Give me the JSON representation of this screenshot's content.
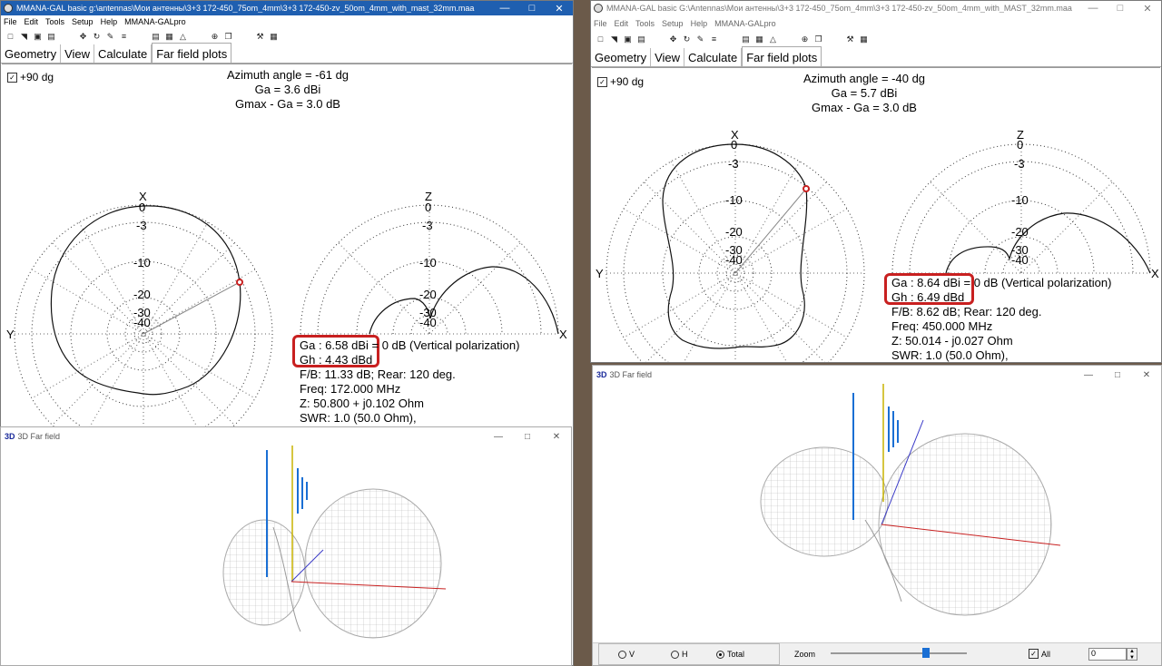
{
  "left": {
    "title": "MMANA-GAL basic g:\\antennas\\Мои антенны\\3+3 172-450_75om_4mm\\3+3 172-450-zv_50om_4mm_with_mast_32mm.maa",
    "menu": [
      "File",
      "Edit",
      "Tools",
      "Setup",
      "Help",
      "MMANA-GALpro"
    ],
    "tabs": [
      "Geometry",
      "View",
      "Calculate",
      "Far field plots"
    ],
    "plus90": "+90 dg",
    "azimuth": "Azimuth angle = -61 dg",
    "ga_line": "Ga = 3.6 dBi",
    "gmax_line": "Gmax - Ga = 3.0 dB",
    "ga_info": "Ga : 6.58 dBi = 0 dB  (Vertical polarization)",
    "gh_info": "Gh : 4.43 dBd",
    "fb": "F/B: 11.33 dB; Rear: 120 deg.",
    "freq": "Freq: 172.000 MHz",
    "z": "Z: 50.800 + j0.102 Ohm",
    "swr": "SWR: 1.0 (50.0 Ohm),",
    "axis_x": "X",
    "axis_y": "Y",
    "axis_z": "Z",
    "ticks": [
      "0",
      "-3",
      "-10",
      "-20",
      "-30",
      "-40"
    ],
    "farfield_title": "3D Far field",
    "logo": "3D"
  },
  "right": {
    "title": "MMANA-GAL basic G:\\Antennas\\Мои антенны\\3+3 172-450_75om_4mm\\3+3 172-450-zv_50om_4mm_with_MAST_32mm.maa",
    "menu": [
      "File",
      "Edit",
      "Tools",
      "Setup",
      "Help",
      "MMANA-GALpro"
    ],
    "tabs": [
      "Geometry",
      "View",
      "Calculate",
      "Far field plots"
    ],
    "plus90": "+90 dg",
    "azimuth": "Azimuth angle = -40 dg",
    "ga_line": "Ga = 5.7 dBi",
    "gmax_line": "Gmax - Ga = 3.0 dB",
    "ga_info": "Ga : 8.64 dBi = 0 dB  (Vertical polarization)",
    "gh_info": "Gh : 6.49 dBd",
    "fb": "F/B: 8.62 dB; Rear: 120 deg.",
    "freq": "Freq: 450.000 MHz",
    "z": "Z: 50.014 - j0.027 Ohm",
    "swr": "SWR: 1.0 (50.0 Ohm),",
    "axis_x": "X",
    "axis_y": "Y",
    "axis_z": "Z",
    "ticks": [
      "0",
      "-3",
      "-10",
      "-20",
      "-30",
      "-40"
    ],
    "farfield_title": "3D Far field",
    "logo": "3D",
    "radio_v": "V",
    "radio_h": "H",
    "radio_total": "Total",
    "zoom_label": "Zoom",
    "all_label": "All",
    "spin_value": "0"
  },
  "colors": {
    "accent_blue": "#1a6fd4",
    "highlight_red": "#c82020",
    "title_bg": "#1f5fb0"
  },
  "icons": {
    "minimize": "minimize-icon",
    "maximize": "maximize-icon",
    "close": "close-icon"
  }
}
